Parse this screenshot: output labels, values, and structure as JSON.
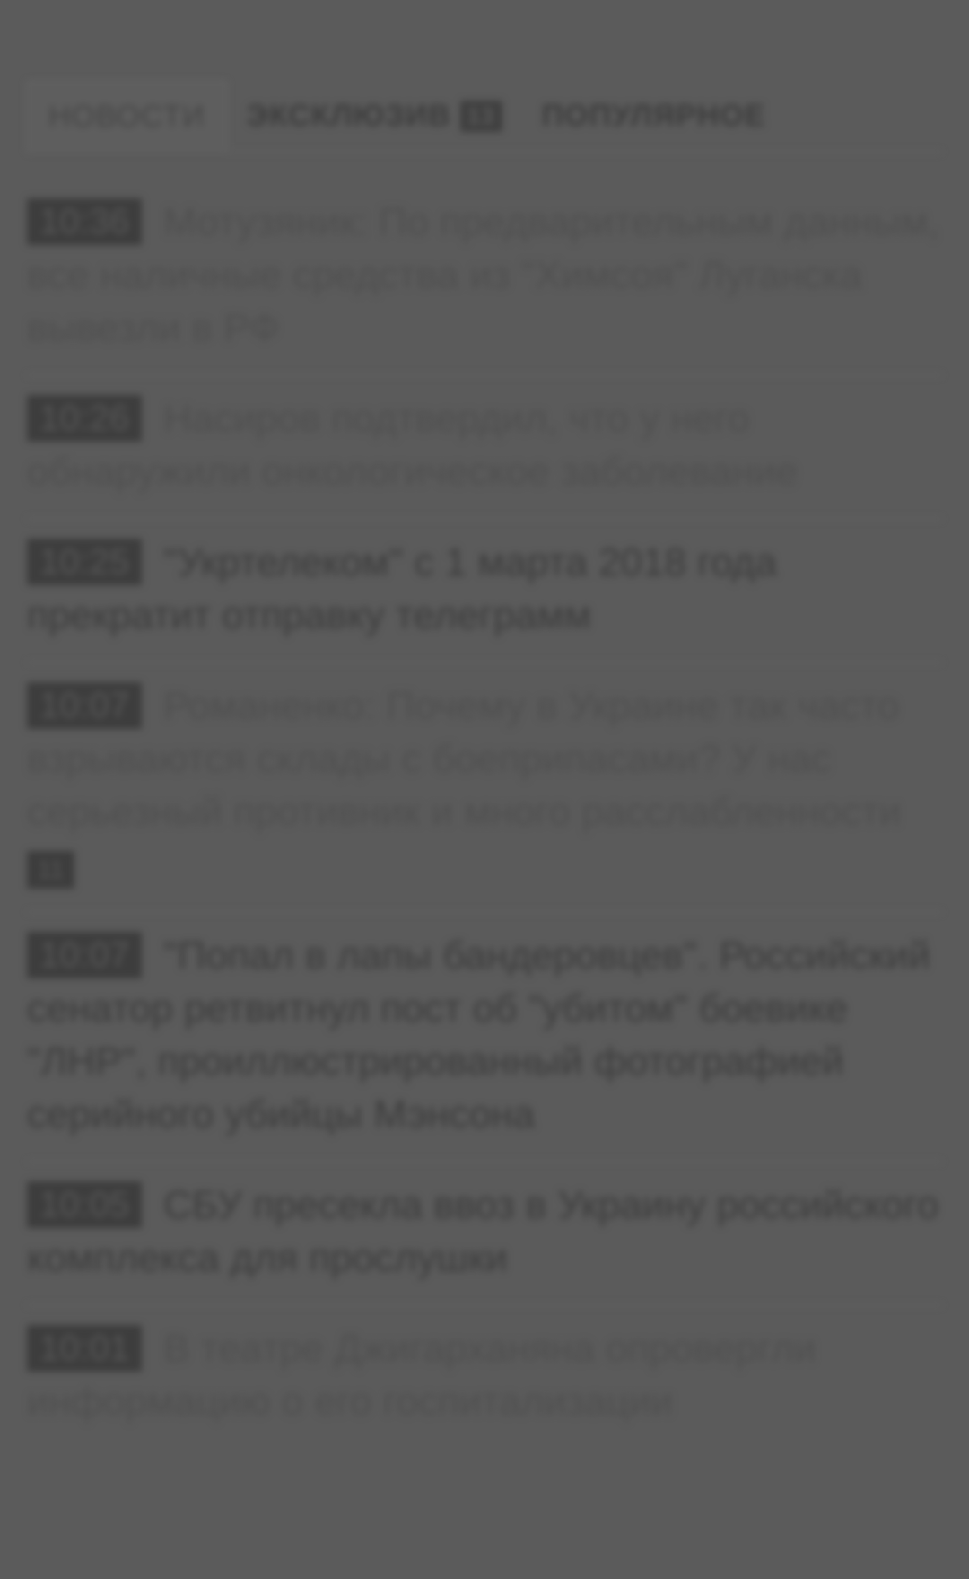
{
  "tabs": [
    {
      "label": "НОВОСТИ"
    },
    {
      "label": "ЭКСКЛЮЗИВ",
      "count": "13"
    },
    {
      "label": "ПОПУЛЯРНОЕ"
    }
  ],
  "news": [
    {
      "time": "10:36",
      "text": "Мотузяник: По предварительным данным, все наличные средства из \"Химсоя\" Луганска вывезли в РФ"
    },
    {
      "time": "10:26",
      "text": "Насиров подтвердил, что у него обнаружили онкологическое заболевание"
    },
    {
      "time": "10:25",
      "text": "\"Укртелеком\" с 1 марта 2018 года прекратит отправку телеграмм"
    },
    {
      "time": "10:07",
      "text": "Романенко: Почему в Украине так часто взрываются склады с боеприпасами? У нас серьезный противник и много расслабленности",
      "badge": "11"
    },
    {
      "time": "10:07",
      "text": "\"Попал в лапы бандеровцев\". Российский сенатор ретвитнул пост об \"убитом\" боевике \"ЛНР\", проиллюстрированный фотографией серийного убийцы Мэнсона"
    },
    {
      "time": "10:05",
      "text": "СБУ пресекла ввоз в Украину российского комплекса для прослушки"
    },
    {
      "time": "10:01",
      "text": "В театре Джигарханяна опровергли информацию о его госпитализации"
    }
  ]
}
